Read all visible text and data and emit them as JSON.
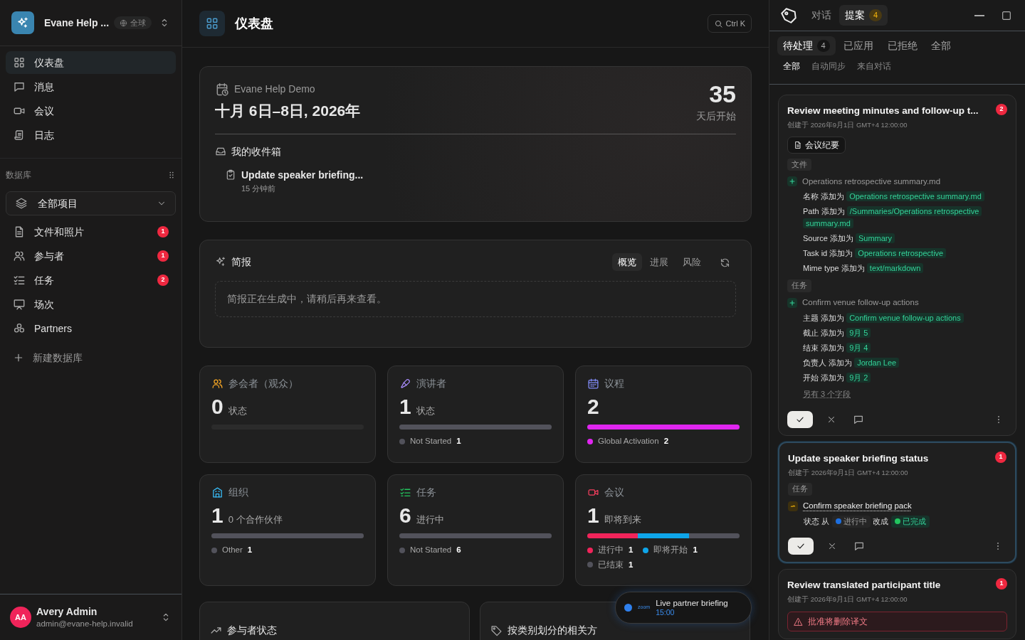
{
  "sidebar": {
    "workspace": {
      "name": "Evane Help ...",
      "scope": "全球"
    },
    "nav": [
      {
        "label": "仪表盘",
        "selected": true
      },
      {
        "label": "消息",
        "selected": false
      },
      {
        "label": "会议",
        "selected": false
      },
      {
        "label": "日志",
        "selected": false
      }
    ],
    "section_label": "数据库",
    "project_select": {
      "value": "全部项目"
    },
    "databases": [
      {
        "label": "文件和照片",
        "badge": "1"
      },
      {
        "label": "参与者",
        "badge": "1"
      },
      {
        "label": "任务",
        "badge": "2"
      },
      {
        "label": "场次"
      },
      {
        "label": "Partners"
      }
    ],
    "new_database": "新建数据库",
    "user": {
      "initials": "AA",
      "name": "Avery Admin",
      "email": "admin@evane-help.invalid"
    }
  },
  "header": {
    "title": "仪表盘",
    "search_shortcut": "Ctrl K"
  },
  "event_card": {
    "name": "Evane Help Demo",
    "dates": "十月 6日–8日, 2026年",
    "countdown": "35",
    "countdown_label": "天后开始",
    "inbox_title": "我的收件箱",
    "inbox_items": [
      {
        "title": "Update speaker briefing...",
        "time": "15 分钟前"
      }
    ]
  },
  "brief": {
    "title": "简报",
    "tabs": [
      {
        "label": "概览",
        "selected": true
      },
      {
        "label": "进展",
        "selected": false
      },
      {
        "label": "风险",
        "selected": false
      }
    ],
    "message": "简报正在生成中，请稍后再来查看。"
  },
  "stats": [
    {
      "title": "参会者（观众）",
      "count": "0",
      "caption": "状态"
    },
    {
      "title": "演讲者",
      "count": "1",
      "caption": "状态",
      "segments": [
        {
          "label": "Not Started",
          "count": "1",
          "color": "#52525b"
        }
      ]
    },
    {
      "title": "议程",
      "count": "2",
      "segments": [
        {
          "label": "Global Activation",
          "count": "2",
          "color": "#e026f0"
        }
      ]
    },
    {
      "title": "组织",
      "count": "1",
      "caption": "0 个合作伙伴",
      "segments": [
        {
          "label": "Other",
          "count": "1",
          "color": "#52525b"
        }
      ]
    },
    {
      "title": "任务",
      "count": "6",
      "caption": "进行中",
      "segments": [
        {
          "label": "Not Started",
          "count": "6",
          "color": "#52525b"
        }
      ]
    },
    {
      "title": "会议",
      "count": "1",
      "caption": "即将到来",
      "segments": [
        {
          "label": "进行中",
          "count": "1",
          "color": "#f0245a"
        },
        {
          "label": "即将开始",
          "count": "1",
          "color": "#0ea5e9"
        },
        {
          "label": "已结束",
          "count": "1",
          "color": "#52525b"
        }
      ]
    }
  ],
  "bottom_cards": [
    {
      "title": "参与者状态"
    },
    {
      "title": "按类别划分的相关方"
    }
  ],
  "toast": {
    "provider": "zoom",
    "title": "Live partner briefing",
    "time": "15:00"
  },
  "panel": {
    "tabs": [
      {
        "label": "对话",
        "selected": false
      },
      {
        "label": "提案",
        "badge": "4",
        "selected": true
      }
    ],
    "filters": [
      {
        "label": "待处理",
        "count": "4",
        "selected": true
      },
      {
        "label": "已应用",
        "selected": false
      },
      {
        "label": "已拒绝",
        "selected": false
      },
      {
        "label": "全部",
        "selected": false
      }
    ],
    "sources": [
      {
        "label": "全部",
        "selected": true
      },
      {
        "label": "自动同步",
        "selected": false
      },
      {
        "label": "来自对话",
        "selected": false
      }
    ],
    "proposals": [
      {
        "title": "Review meeting minutes and follow-up t...",
        "created": "创建于 2026年9月1日 GMT+4 12:00:00",
        "badge": "2",
        "selected": false,
        "chip": "会议纪要",
        "actions": true,
        "more": "另有 3 个字段",
        "groups": [
          {
            "label": "文件",
            "changes": [
              {
                "kind": "add",
                "title": "Operations retrospective summary.md",
                "fields": [
                  {
                    "kind": "value",
                    "label": "名称 添加为",
                    "value": "Operations retrospective summary.md"
                  },
                  {
                    "kind": "value",
                    "label": "Path 添加为",
                    "value": "/Summaries/Operations retrospective summary.md"
                  },
                  {
                    "kind": "value",
                    "label": "Source 添加为",
                    "value": "Summary"
                  },
                  {
                    "kind": "value",
                    "label": "Task id 添加为",
                    "value": "Operations retrospective"
                  },
                  {
                    "kind": "value",
                    "label": "Mime type 添加为",
                    "value": "text/markdown"
                  }
                ]
              }
            ]
          },
          {
            "label": "任务",
            "changes": [
              {
                "kind": "add",
                "title": "Confirm venue follow-up actions",
                "fields": [
                  {
                    "kind": "value",
                    "label": "主题 添加为",
                    "value": "Confirm venue follow-up actions"
                  },
                  {
                    "kind": "value",
                    "label": "截止 添加为",
                    "value": "9月 5"
                  },
                  {
                    "kind": "value",
                    "label": "结束 添加为",
                    "value": "9月 4"
                  },
                  {
                    "kind": "value",
                    "label": "负责人 添加为",
                    "value": "Jordan Lee"
                  },
                  {
                    "kind": "value",
                    "label": "开始 添加为",
                    "value": "9月 2"
                  }
                ]
              }
            ]
          }
        ]
      },
      {
        "title": "Update speaker briefing status",
        "created": "创建于 2026年9月1日 GMT+4 12:00:00",
        "badge": "1",
        "selected": true,
        "actions": true,
        "groups": [
          {
            "label": "任务",
            "changes": [
              {
                "kind": "update",
                "title": "Confirm speaker briefing pack",
                "fields": [
                  {
                    "kind": "status",
                    "label": "状态 从",
                    "from": {
                      "text": "进行中",
                      "color": "#1d6fe0"
                    },
                    "joiner": "改成",
                    "to": {
                      "text": "已完成",
                      "color": "#22c55e"
                    }
                  }
                ]
              }
            ]
          }
        ]
      },
      {
        "title": "Review translated participant title",
        "created": "创建于 2026年9月1日 GMT+4 12:00:00",
        "badge": "1",
        "selected": false,
        "actions": false,
        "warning": "批准将删除译文"
      }
    ]
  }
}
